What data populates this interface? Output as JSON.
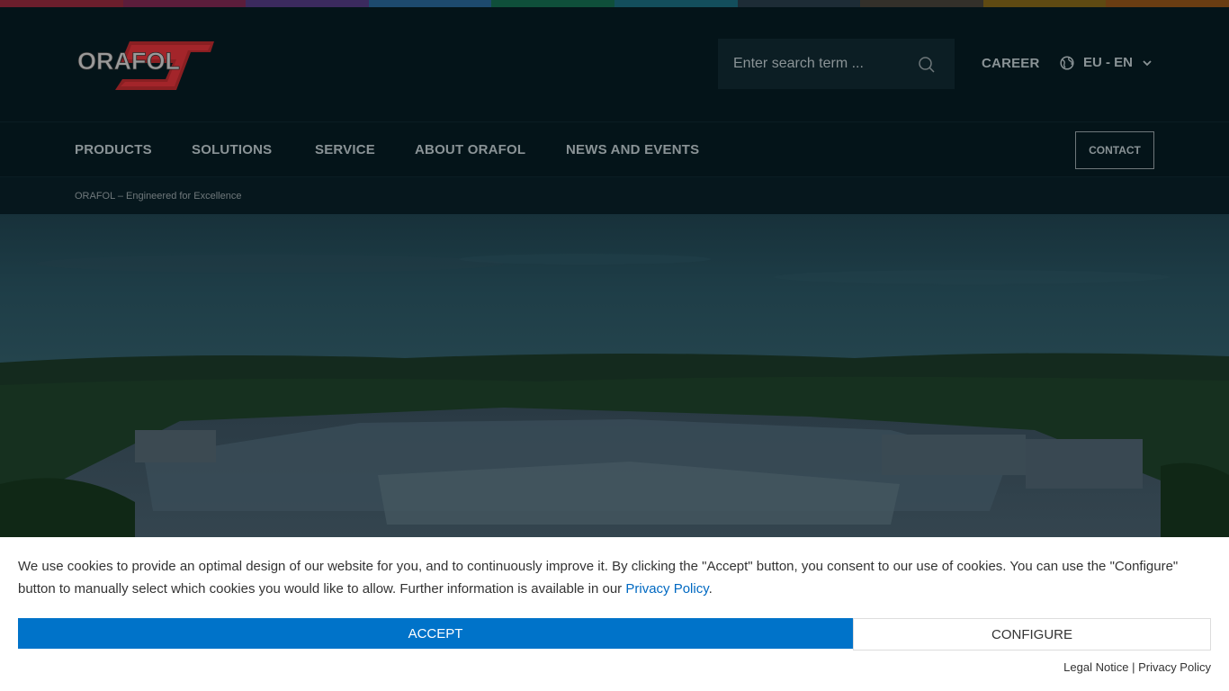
{
  "stripe_colors": [
    "#6b1e2c",
    "#5b1d3b",
    "#3b2a5e",
    "#1d4a6e",
    "#0f4f3a",
    "#134e5c",
    "#1d2c36",
    "#33302a",
    "#5f4a12",
    "#6a3d12"
  ],
  "brand": {
    "logo_text": "ORAFOL",
    "red": "#c0282d",
    "grey": "#b9b9b9"
  },
  "header": {
    "search_placeholder": "Enter search term ...",
    "career": "CAREER",
    "region": "EU - EN"
  },
  "nav": {
    "items": [
      "PRODUCTS",
      "SOLUTIONS",
      "SERVICE",
      "ABOUT ORAFOL",
      "NEWS AND EVENTS"
    ],
    "contact": "CONTACT"
  },
  "tagline": "ORAFOL – Engineered for Excellence",
  "cookie": {
    "text_before_link": "We use cookies to provide an optimal design of our website for you, and to continuously improve it. By clicking the \"Accept\" button, you consent to our use of cookies. You can use the \"Configure\" button to manually select which cookies you would like to allow. Further information is available in our ",
    "link_text": "Privacy Policy",
    "text_after_link": ".",
    "accept_label": "ACCEPT",
    "configure_label": "CONFIGURE",
    "legal_notice": "Legal Notice",
    "separator": "|",
    "privacy_policy": "Privacy Policy"
  }
}
